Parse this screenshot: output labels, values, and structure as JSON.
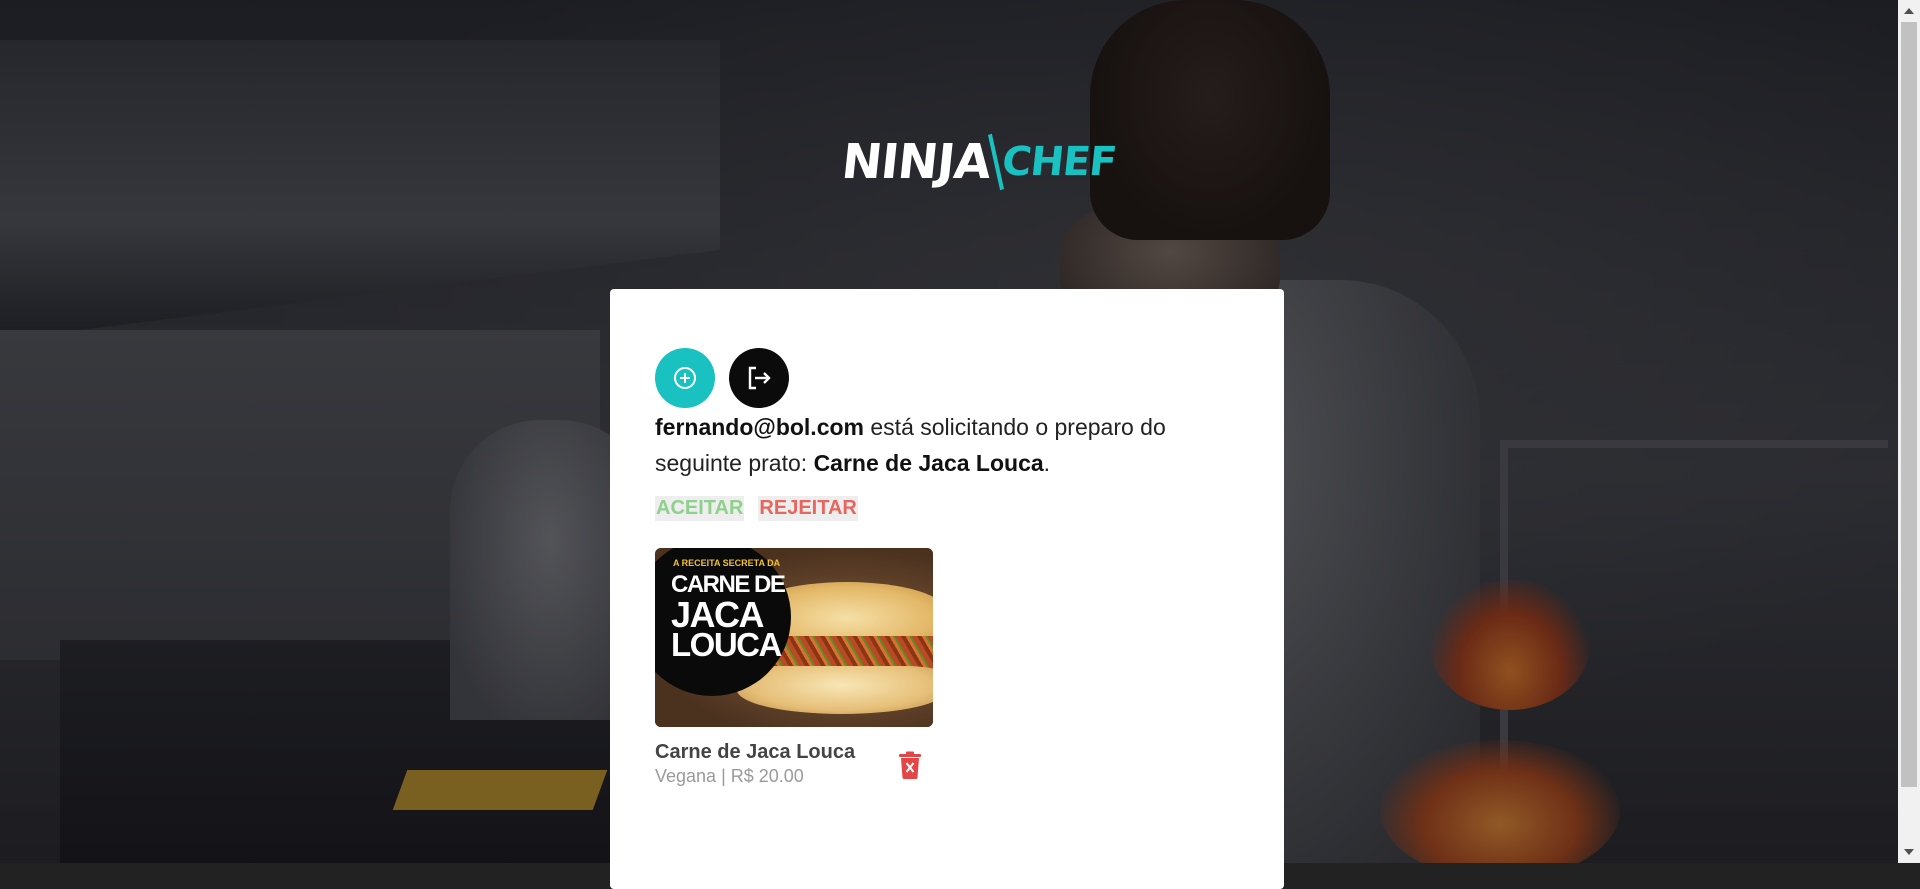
{
  "brand": {
    "logo_left": "NINJA",
    "logo_right": "CHEF",
    "accent_color": "#19c2c1"
  },
  "toolbar": {
    "add_icon": "plus-circle-icon",
    "logout_icon": "logout-icon"
  },
  "request": {
    "email": "fernando@bol.com",
    "text_middle": " está solicitando o preparo do seguinte prato: ",
    "dish": "Carne de Jaca Louca",
    "text_end": ".",
    "accept_label": "ACEITAR",
    "reject_label": "REJEITAR",
    "accept_color": "#8fd18c",
    "reject_color": "#e6675f"
  },
  "dish_card": {
    "image_caption_small": "A RECEITA SECRETA DA",
    "image_caption_line1": "CARNE DE",
    "image_caption_line2": "JACA",
    "image_caption_line3": "LOUCA",
    "name": "Carne de Jaca Louca",
    "meta": "Vegana | R$ 20.00",
    "delete_icon": "trash-icon"
  }
}
